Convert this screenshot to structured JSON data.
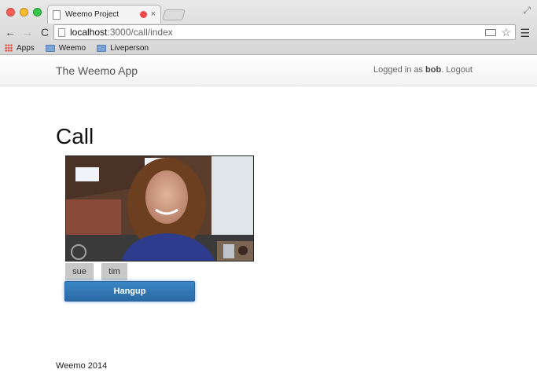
{
  "browser": {
    "tab_title": "Weemo Project",
    "tab_close": "×",
    "url_host": "localhost",
    "url_path": ":3000/call/index",
    "menu_glyph": "☰",
    "star_glyph": "☆",
    "back_glyph": "←",
    "forward_glyph": "→",
    "reload_glyph": "C",
    "resize_glyph": "⤢",
    "bookmarks": [
      {
        "label": "Apps",
        "icon": "apps-grid-icon"
      },
      {
        "label": "Weemo",
        "icon": "folder-icon"
      },
      {
        "label": "Liveperson",
        "icon": "folder-icon"
      }
    ]
  },
  "navbar": {
    "brand": "The Weemo App",
    "logged_in_prefix": "Logged in as ",
    "username": "bob",
    "separator": ".",
    "logout": "Logout"
  },
  "page": {
    "title": "Call",
    "users": [
      "sue",
      "tim"
    ],
    "hangup_label": "Hangup",
    "footer": "Weemo 2014"
  },
  "colors": {
    "accent_button": "#2f74b3",
    "user_button": "#c8c8c8"
  }
}
